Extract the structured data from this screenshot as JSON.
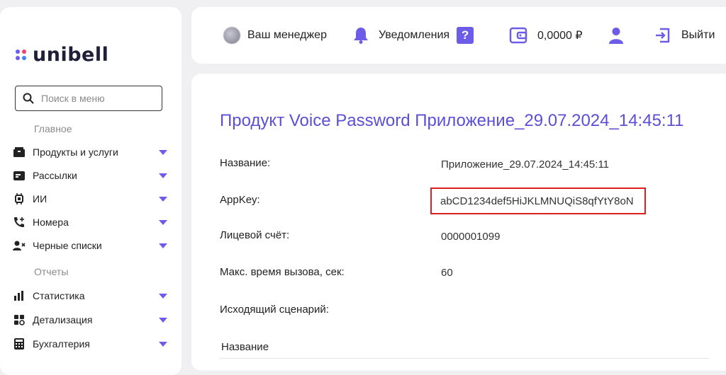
{
  "brand": {
    "name": "unibell"
  },
  "search": {
    "placeholder": "Поиск в меню"
  },
  "sidebar": {
    "sections": [
      {
        "title": "Главное",
        "items": [
          {
            "label": "Продукты и услуги",
            "icon": "box-icon"
          },
          {
            "label": "Рассылки",
            "icon": "message-icon"
          },
          {
            "label": "ИИ",
            "icon": "chip-icon"
          },
          {
            "label": "Номера",
            "icon": "phone-plus-icon"
          },
          {
            "label": "Черные списки",
            "icon": "user-block-icon"
          }
        ]
      },
      {
        "title": "Отчеты",
        "items": [
          {
            "label": "Статистика",
            "icon": "chart-icon"
          },
          {
            "label": "Детализация",
            "icon": "detail-icon"
          },
          {
            "label": "Бухгалтерия",
            "icon": "calculator-icon"
          }
        ]
      }
    ]
  },
  "topbar": {
    "manager": "Ваш менеджер",
    "notifications": "Уведомления",
    "help": "?",
    "balance": "0,0000 ₽",
    "logout": "Выйти"
  },
  "product": {
    "title": "Продукт Voice Password Приложение_29.07.2024_14:45:11",
    "fields": [
      {
        "label": "Название:",
        "value": "Приложение_29.07.2024_14:45:11"
      },
      {
        "label": "AppKey:",
        "value": "abCD1234def5HiJKLMNUQiS8qfYtY8oN"
      },
      {
        "label": "Лицевой счёт:",
        "value": "0000001099"
      },
      {
        "label": "Макс. время вызова, сек:",
        "value": "60"
      },
      {
        "label": "Исходящий сценарий:",
        "value": ""
      }
    ],
    "table_header": "Название"
  },
  "colors": {
    "accent": "#6c5ce7",
    "highlight": "#e01e1e",
    "title": "#5a4fd6"
  }
}
